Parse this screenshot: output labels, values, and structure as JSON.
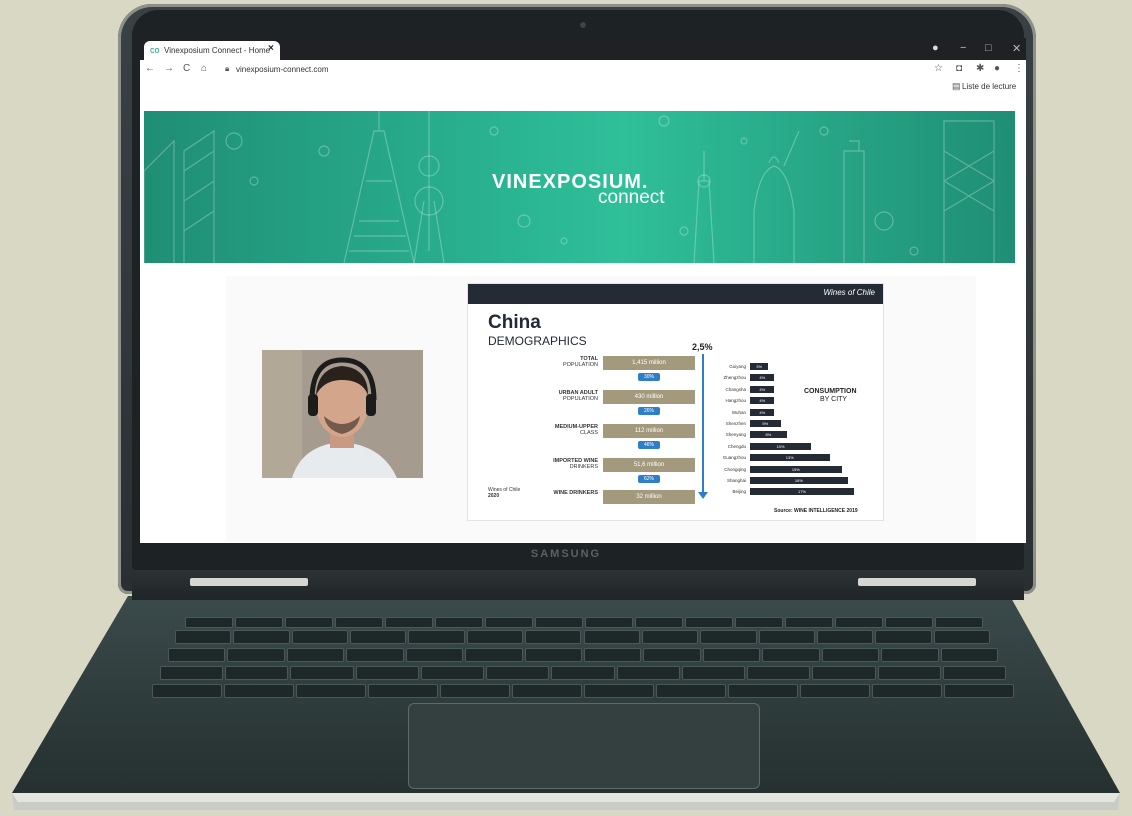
{
  "browser": {
    "tab_title": "Vinexposium Connect - Home",
    "tab_icon": "co",
    "url": "vinexposium-connect.com",
    "reading_list": "Liste de lecture",
    "nav": {
      "back": "←",
      "forward": "→",
      "reload": "C",
      "home": "⌂"
    },
    "window_controls": {
      "minimize": "−",
      "maximize": "□",
      "close": "✕"
    }
  },
  "banner": {
    "logo_main": "VINEXPOSIUM.",
    "logo_sub": "connect"
  },
  "laptop": {
    "brand": "SAMSUNG"
  },
  "slide": {
    "header_logo": "Wines of Chile",
    "title": "China",
    "subtitle": "DEMOGRAPHICS",
    "growth": "2,5%",
    "funnel": [
      {
        "label": "TOTAL",
        "sublabel": "POPULATION",
        "value": "1,415 million"
      },
      {
        "label": "URBAN ADULT",
        "sublabel": "POPULATION",
        "value": "430 million"
      },
      {
        "label": "MEDIUM-UPPER",
        "sublabel": "CLASS",
        "value": "112 million"
      },
      {
        "label": "IMPORTED WINE",
        "sublabel": "DRINKERS",
        "value": "51,6 million"
      },
      {
        "label": "WINE DRINKERS",
        "sublabel": "",
        "value": "32 million"
      }
    ],
    "funnel_pcts": [
      "30%",
      "26%",
      "46%",
      "62%"
    ],
    "consumption_title": "CONSUMPTION",
    "consumption_sub": "BY CITY",
    "cities": [
      {
        "name": "Guiyang",
        "pct": "3%",
        "value": 3
      },
      {
        "name": "Zhengzhou",
        "pct": "4%",
        "value": 4
      },
      {
        "name": "Changsha",
        "pct": "4%",
        "value": 4
      },
      {
        "name": "Hangzhou",
        "pct": "4%",
        "value": 4
      },
      {
        "name": "Wuhan",
        "pct": "4%",
        "value": 4
      },
      {
        "name": "Shenzhen",
        "pct": "5%",
        "value": 5
      },
      {
        "name": "Shenyang",
        "pct": "6%",
        "value": 6
      },
      {
        "name": "Chengdu",
        "pct": "10%",
        "value": 10
      },
      {
        "name": "Guangzhou",
        "pct": "13%",
        "value": 13
      },
      {
        "name": "Chongqing",
        "pct": "15%",
        "value": 15
      },
      {
        "name": "Shanghai",
        "pct": "16%",
        "value": 16
      },
      {
        "name": "Beijing",
        "pct": "17%",
        "value": 17
      }
    ],
    "source": "Source: WINE INTELLIGENCE 2019",
    "footer": "Wines of Chile",
    "footer_year": "2020"
  },
  "colors": {
    "banner": "#2bb794",
    "funnel_box": "#a39a7d",
    "arrow": "#2f7fc8",
    "bar": "#242b34"
  }
}
